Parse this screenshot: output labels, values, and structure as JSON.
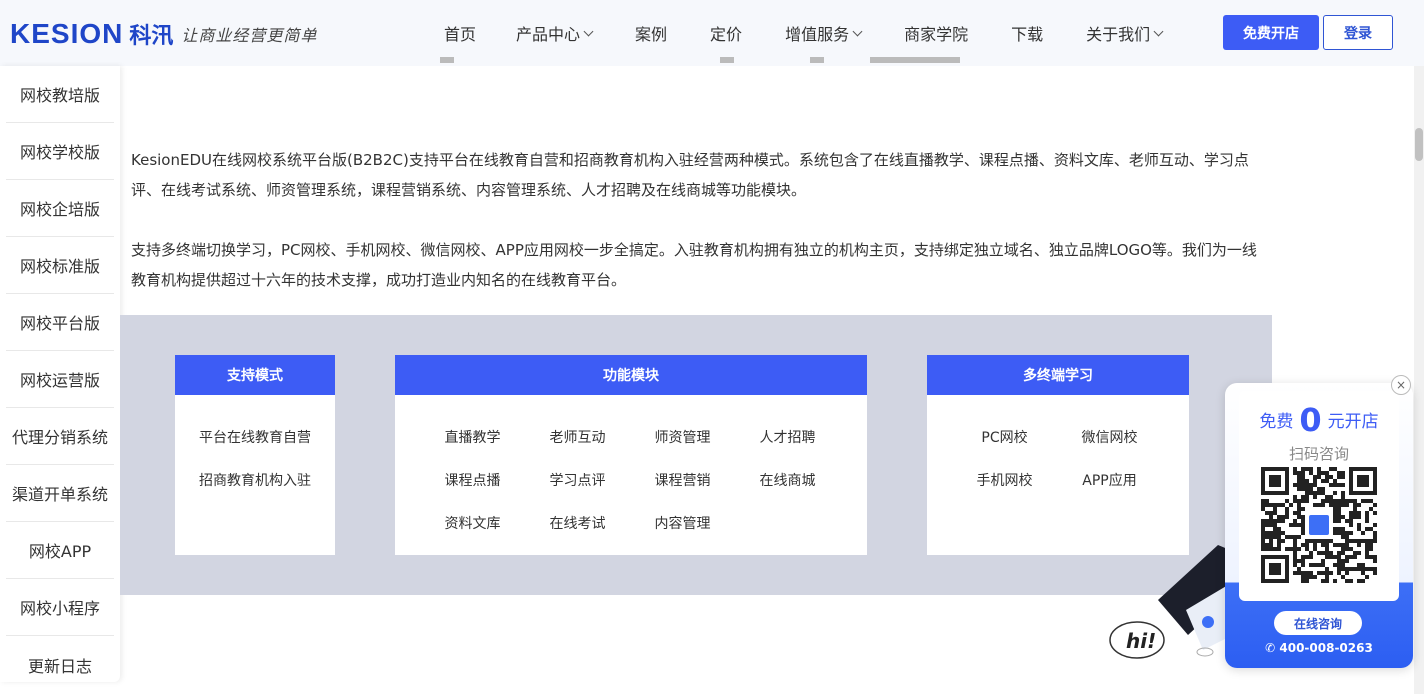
{
  "header": {
    "logo_en": "KESION",
    "logo_cn": "科汛",
    "slogan": "让商业经营更简单",
    "nav": [
      {
        "label": "首页",
        "dropdown": false
      },
      {
        "label": "产品中心",
        "dropdown": true
      },
      {
        "label": "案例",
        "dropdown": false
      },
      {
        "label": "定价",
        "dropdown": false
      },
      {
        "label": "增值服务",
        "dropdown": true
      },
      {
        "label": "商家学院",
        "dropdown": false
      },
      {
        "label": "下载",
        "dropdown": false
      },
      {
        "label": "关于我们",
        "dropdown": true
      }
    ],
    "open_label": "免费开店",
    "login_label": "登录"
  },
  "sidebar": {
    "items": [
      "网校教培版",
      "网校学校版",
      "网校企培版",
      "网校标准版",
      "网校平台版",
      "网校运营版",
      "代理分销系统",
      "渠道开单系统",
      "网校APP",
      "网校小程序",
      "更新日志"
    ]
  },
  "description": {
    "p1": "KesionEDU在线网校系统平台版(B2B2C)支持平台在线教育自营和招商教育机构入驻经营两种模式。系统包含了在线直播教学、课程点播、资料文库、老师互动、学习点评、在线考试系统、师资管理系统，课程营销系统、内容管理系统、人才招聘及在线商城等功能模块。",
    "p2": "支持多终端切换学习，PC网校、手机网校、微信网校、APP应用网校一步全搞定。入驻教育机构拥有独立的机构主页，支持绑定独立域名、独立品牌LOGO等。我们为一线教育机构提供超过十六年的技术支撑，成功打造业内知名的在线教育平台。"
  },
  "boxes": {
    "mode": {
      "title": "支持模式",
      "items": [
        "平台在线教育自营",
        "招商教育机构入驻"
      ]
    },
    "modules": {
      "title": "功能模块",
      "items": [
        "直播教学",
        "老师互动",
        "师资管理",
        "人才招聘",
        "课程点播",
        "学习点评",
        "课程营销",
        "在线商城",
        "资料文库",
        "在线考试",
        "内容管理"
      ]
    },
    "terminals": {
      "title": "多终端学习",
      "items": [
        "PC网校",
        "微信网校",
        "手机网校",
        "APP应用"
      ]
    }
  },
  "float_card": {
    "title_pre": "免费",
    "title_num": "0",
    "title_post": "元开店",
    "subtitle": "扫码咨询",
    "consult_label": "在线咨询",
    "phone": "400-008-0263",
    "close_label": "×"
  },
  "mascot_text": "hi!",
  "colors": {
    "brand": "#3d5cf5",
    "panel_bg": "#d2d5e1",
    "header_bg": "#f6f8fc"
  }
}
